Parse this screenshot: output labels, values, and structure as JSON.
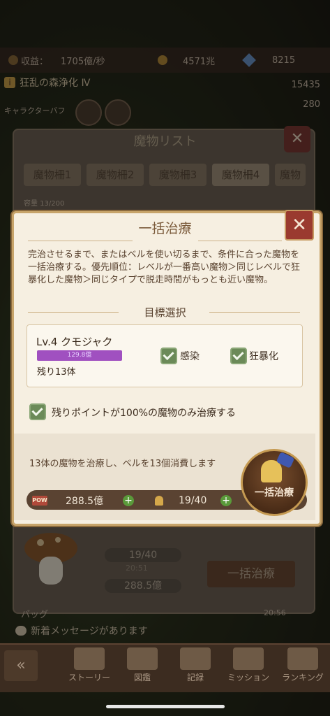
{
  "status": {
    "income_label": "収益：",
    "income_value": "1705億/秒",
    "coin_value": "4571兆",
    "gem_value": "8215"
  },
  "quest": {
    "title": "狂乱の森浄化 Ⅳ",
    "icon": "i",
    "num1": "15435",
    "num2": "280"
  },
  "character_buff_label": "キャラクターバフ",
  "back_dialog": {
    "title": "魔物リスト",
    "tabs": [
      "魔物柵1",
      "魔物柵2",
      "魔物柵3",
      "魔物柵4",
      "魔物柵"
    ],
    "capacity": "容量 13/200"
  },
  "modal": {
    "title": "一括治療",
    "close": "✕",
    "description": "完治させるまで、またはベルを使い切るまで、条件に合った魔物を一括治療する。優先順位：レベルが一番高い魔物＞同じレベルで狂暴化した魔物＞同じタイプで脱走時間がもっとも近い魔物。",
    "target_section": "目標選択",
    "monster": {
      "level_name": "Lv.4 クモジャク",
      "bar_text": "129.8億",
      "remaining": "残り13体"
    },
    "check_infection": "感染",
    "check_frenzy": "狂暴化",
    "check_only_full": "残りポイントが100%の魔物のみ治療する",
    "consume_text": "13体の魔物を治療し、ベルを13個消費します",
    "pow_label": "POW",
    "pow_value": "288.5億",
    "bell_value": "19/40",
    "button_label": "一括治療"
  },
  "background_lower": {
    "bell_value": "19/40",
    "timer": "20:51",
    "pow_value": "288.5億",
    "button_label": "一括治療"
  },
  "bag_label": "バッグ",
  "time": "20:56",
  "new_message": "新着メッセージがあります",
  "nav": [
    {
      "label": "ストーリー"
    },
    {
      "label": "図鑑"
    },
    {
      "label": "記録"
    },
    {
      "label": "ミッション"
    },
    {
      "label": "ランキング"
    }
  ],
  "colors": {
    "accent": "#9a3a2f",
    "panel": "#f6efe1",
    "check": "#6b8a58",
    "bar": "#a050c0"
  }
}
